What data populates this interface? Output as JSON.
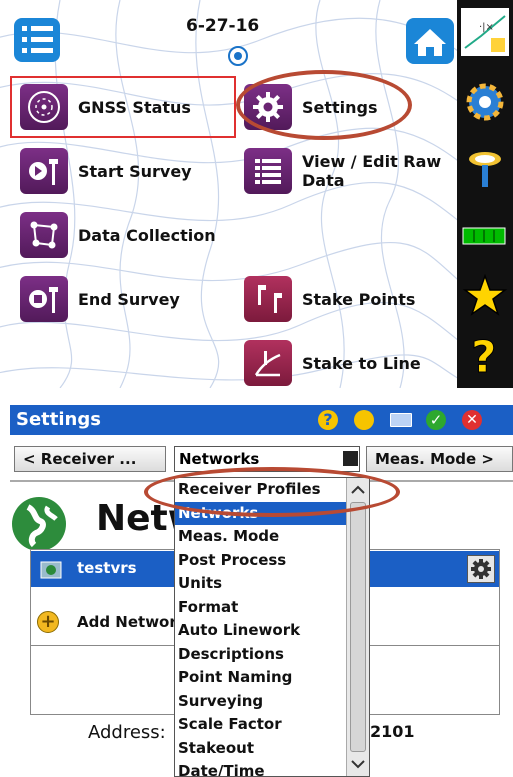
{
  "top": {
    "date": "6-27-16",
    "menu_items": [
      {
        "id": "gnss",
        "label": "GNSS Status"
      },
      {
        "id": "settings",
        "label": "Settings"
      },
      {
        "id": "start",
        "label": "Start Survey"
      },
      {
        "id": "viewedit",
        "label": "View / Edit Raw Data"
      },
      {
        "id": "datacoll",
        "label": "Data Collection"
      },
      {
        "id": "end",
        "label": "End Survey"
      },
      {
        "id": "stake",
        "label": "Stake Points"
      },
      {
        "id": "staketoline",
        "label": "Stake to Line"
      }
    ],
    "toolbar_icons": [
      "map-icon",
      "gear-icon",
      "rover-icon",
      "battery-icon",
      "star-icon",
      "help-icon"
    ]
  },
  "settings": {
    "title": "Settings",
    "nav_prev": "< Receiver ...",
    "nav_next": "Meas. Mode >",
    "combo_value": "Networks",
    "section_title": "Networks",
    "network_row": "testvrs",
    "add_network": "Add Network",
    "address_label": "Address:",
    "address_value": "2101",
    "dropdown": [
      "Receiver Profiles",
      "Networks",
      "Meas. Mode",
      "Post Process",
      "Units",
      "Format",
      "Auto Linework",
      "Descriptions",
      "Point Naming",
      "Surveying",
      "Scale Factor",
      "Stakeout",
      "Date/Time"
    ],
    "dropdown_selected": "Networks"
  },
  "colors": {
    "accent_blue": "#1b5fc5",
    "icon_purple": "#6a2472",
    "highlight_ellipse": "#b84a33",
    "selection_red": "#e03030"
  }
}
